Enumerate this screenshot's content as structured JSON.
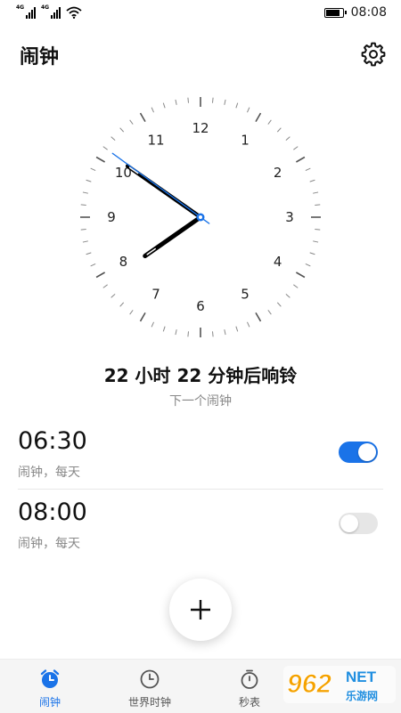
{
  "status_bar": {
    "time": "08:08",
    "sim1": "4G",
    "sim2": "4G",
    "icons": [
      "signal-icon",
      "signal-icon",
      "wifi-icon",
      "battery-icon"
    ]
  },
  "header": {
    "title": "闹钟",
    "settings_icon": "gear-icon"
  },
  "clock": {
    "numerals": [
      "12",
      "1",
      "2",
      "3",
      "4",
      "5",
      "6",
      "7",
      "8",
      "9",
      "10",
      "11"
    ],
    "time_shown": "07:50:51",
    "colors": {
      "hands": "#000000",
      "second_hand": "#1a73e8",
      "ticks": "#888888"
    }
  },
  "countdown": {
    "text": "22 小时  22 分钟后响铃",
    "label": "下一个闹钟"
  },
  "alarms": [
    {
      "time": "06:30",
      "detail": "闹钟，每天",
      "enabled": true
    },
    {
      "time": "08:00",
      "detail": "闹钟，每天",
      "enabled": false
    }
  ],
  "fab": {
    "icon": "plus-icon"
  },
  "bottom_nav": [
    {
      "label": "闹钟",
      "icon": "alarm-clock-icon",
      "active": true
    },
    {
      "label": "世界时钟",
      "icon": "clock-icon",
      "active": false
    },
    {
      "label": "秒表",
      "icon": "stopwatch-icon",
      "active": false
    }
  ],
  "watermark": {
    "number": "962",
    "suffix": "NET",
    "sub": "乐游网"
  },
  "colors": {
    "accent": "#1a73e8",
    "text": "#111111",
    "secondary_text": "#888888"
  }
}
